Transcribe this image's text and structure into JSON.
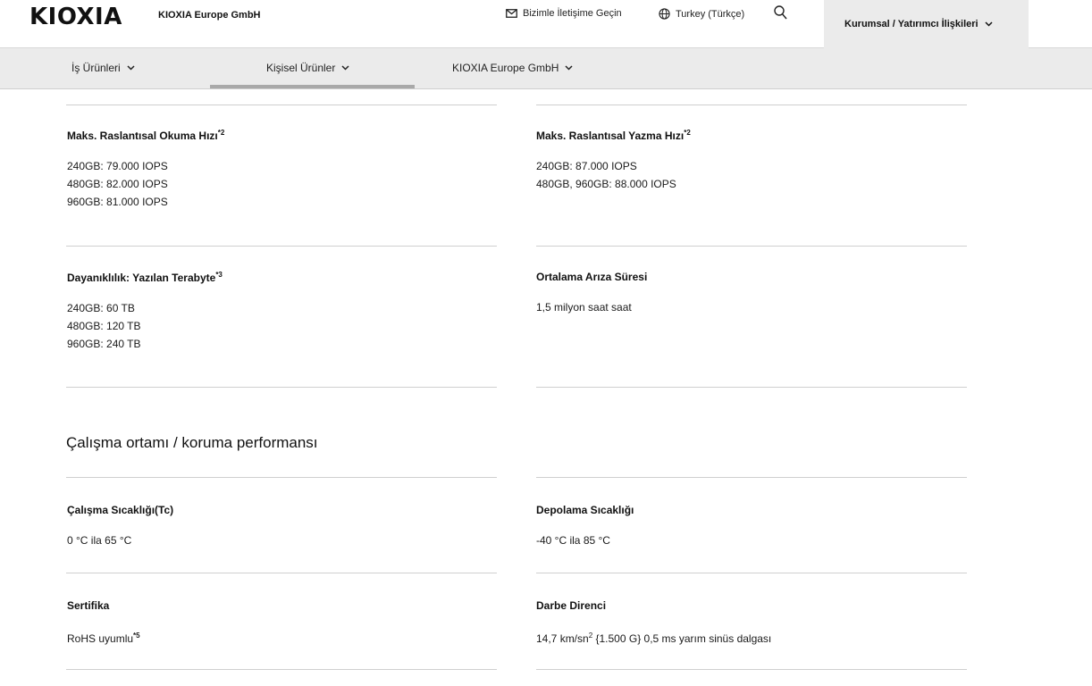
{
  "header": {
    "logo": "KIOXIA",
    "company": "KIOXIA Europe GmbH",
    "contact": "Bizimle İletişime Geçin",
    "region": "Turkey (Türkçe)",
    "corporate": "Kurumsal / Yatırımcı İlişkileri"
  },
  "nav": {
    "items": [
      {
        "label": "İş Ürünleri"
      },
      {
        "label": "Kişisel Ürünler"
      },
      {
        "label": "KIOXIA Europe GmbH"
      }
    ]
  },
  "specs": {
    "random_read": {
      "title": "Maks. Raslantısal Okuma Hızı",
      "note": "*2",
      "lines": [
        "240GB: 79.000 IOPS",
        "480GB: 82.000 IOPS",
        "960GB: 81.000 IOPS"
      ]
    },
    "random_write": {
      "title": "Maks. Raslantısal Yazma Hızı",
      "note": "*2",
      "lines": [
        "240GB: 87.000 IOPS",
        "480GB, 960GB: 88.000 IOPS"
      ]
    },
    "endurance": {
      "title": "Dayanıklılık: Yazılan Terabyte",
      "note": "*3",
      "lines": [
        "240GB: 60 TB",
        "480GB: 120 TB",
        "960GB: 240 TB"
      ]
    },
    "mttf": {
      "title": "Ortalama Arıza Süresi",
      "lines": [
        "1,5 milyon saat saat"
      ]
    }
  },
  "environment": {
    "section_title": "Çalışma ortamı / koruma performansı",
    "operating_temp": {
      "title": "Çalışma Sıcaklığı(Tc)",
      "value": "0 °C ila 65 °C"
    },
    "storage_temp": {
      "title": "Depolama Sıcaklığı",
      "value": "-40 °C ila 85 °C"
    },
    "certification": {
      "title": "Sertifika",
      "value": "RoHS uyumlu",
      "note": "*5"
    },
    "shock": {
      "title": "Darbe Direnci",
      "value_a": "14,7 km/sn",
      "value_sup": "2",
      "value_b": " {1.500 G} 0,5 ms yarım sinüs dalgası"
    }
  }
}
